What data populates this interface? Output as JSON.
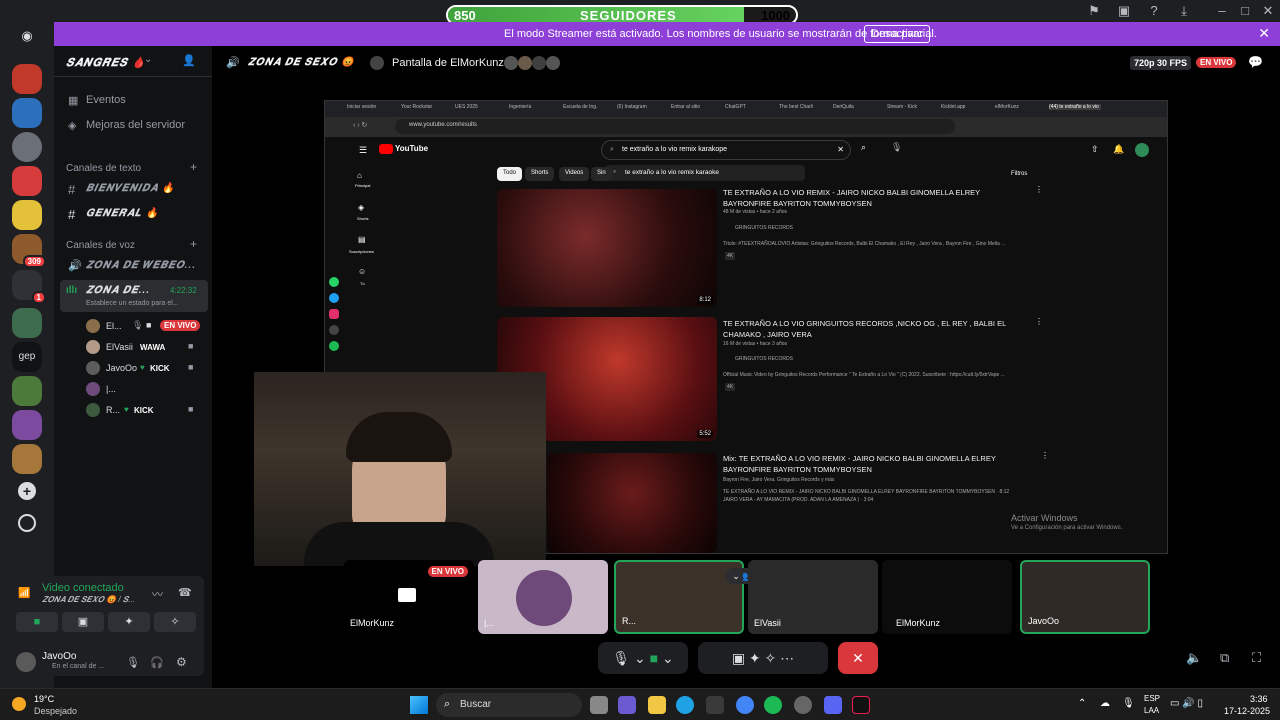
{
  "title_bar": {
    "subs_current": "850",
    "subs_label": "SEGUIDORES",
    "subs_goal": "1000",
    "subs_progress": 0.85
  },
  "banner": {
    "text": "El modo Streamer está activado. Los nombres de usuario se mostrarán de forma parcial.",
    "button": "Desactivar",
    "close": "✕"
  },
  "rail": {
    "badges": [
      "309",
      "1"
    ],
    "gep": "gep"
  },
  "sidebar": {
    "server_name": "𝑺𝑨𝑵𝑮𝑹𝑬𝑺 🩸",
    "events": "Eventos",
    "improvements": "Mejoras del servidor",
    "text_category": "Canales de texto",
    "text_channels": [
      "𝑩𝑰𝑬𝑵𝑽𝑬𝑵𝑰𝑫𝑨 🔥",
      "𝑮𝑬𝑵𝑬𝑹𝑨𝑳 🔥"
    ],
    "voice_category": "Canales de voz",
    "voice_channel_1": "𝒁𝑶𝑵𝑨 𝑫𝑬 𝑾𝑬𝑩𝑬𝑶...",
    "voice_channel_2": "𝒁𝑶𝑵𝑨 𝑫𝑬...",
    "voice_timer": "4:22:32",
    "status_hint": "Establece un estado para el...",
    "users": [
      {
        "name": "El...",
        "tag": "EN VIVO"
      },
      {
        "name": "ElVasii",
        "tag": "WAWA"
      },
      {
        "name": "JavoOo",
        "tag": "KICK"
      },
      {
        "name": "|...",
        "tag": ""
      },
      {
        "name": "R...",
        "tag": "KICK"
      }
    ]
  },
  "voice_panel": {
    "status": "Video conectado",
    "channel": "𝒁𝑶𝑵𝑨 𝑫𝑬 𝑺𝑬𝑿𝑶 😡 / 𝑺...",
    "user": "JavoOo",
    "user_status": "En el canal de ..."
  },
  "call_header": {
    "channel": "𝒁𝑶𝑵𝑨 𝑫𝑬 𝑺𝑬𝑿𝑶 😡",
    "screen_share": "Pantalla de ElMorKunz",
    "quality": "720p 30 FPS",
    "live": "EN VIVO"
  },
  "youtube": {
    "tabs": [
      "Iniciar sesión",
      "Your Rockstar",
      "UES 2025",
      "Ingeniería",
      "Escuela de Ing.",
      "(6) Instagram",
      "Entrar al sitio",
      "ChatGPT",
      "The best Charli",
      "DeriQuila",
      "Stream - Kick",
      "Kicklet.app",
      "elMorKunz",
      "(44) te extraño a lo vio"
    ],
    "url": "www.youtube.com/results",
    "logo": "YouTube",
    "search": "te extraño a lo vio remix karakope",
    "suggestion": "te extraño a lo vio remix karaoke",
    "filters": "Filtros",
    "chips": [
      "Todo",
      "Shorts",
      "Videos",
      "Sin"
    ],
    "nav": [
      "Principal",
      "Shorts",
      "Suscripciones",
      "Tú"
    ],
    "videos": [
      {
        "title": "TE EXTRAÑO A LO VIO REMIX - JAIRO NICKO BALBI GINOMELLA ELREY BAYRONFIRE BAYRITON TOMMYBOYSEN",
        "meta": "48 M de vistas • hace 2 años",
        "channel": "GRINGUITOS RECORDS",
        "desc": "Título: #TEEXTRAÑOALOVIO Artistas: Gringuitos Records, Balbi El Chamako , El Rey , Jairo Vera , Bayron Fire , Gino Mella ...",
        "badge": "4K",
        "duration": "8:12"
      },
      {
        "title": "TE EXTRAÑO A LO VIO GRINGUITOS RECORDS ,NICKO OG , EL REY , BALBI EL CHAMAKO , JAIRO VERA",
        "meta": "16 M de vistas • hace 3 años",
        "channel": "GRINGUITOS RECORDS",
        "desc": "Official Music Video by Gringuitos Records Performance \" Te Extraño a Lo Vio \" (C) 2022. Suscribete : https://cutt.ly/0xtrVape ...",
        "badge": "4K",
        "duration": "5:52"
      },
      {
        "title": "Mix: TE EXTRAÑO A LO VIO REMIX - JAIRO NICKO  BALBI GINOMELLA ELREY BAYRONFIRE BAYRITON TOMMYBOYSEN",
        "meta": "Bayron Fire, Jairo Vera, Gringuitos Records y más",
        "desc": "TE EXTRAÑO A LO VIO REMIX - JAIRO NICKO BALBI GINOMELLA ELREY BAYRONFIRE BAYRITON TOMMYBOYSEN · 8:12",
        "desc2": "JAIRO VERA - AY MAMACITA (PROD. ADAN LA AMENAZA ) · 3:04"
      }
    ],
    "watermark_1": "Activar Windows",
    "watermark_2": "Ve a Configuración para activar Windows."
  },
  "tiles": [
    {
      "name": "ElMorKunz",
      "live": "EN VIVO"
    },
    {
      "name": "|..."
    },
    {
      "name": "R..."
    },
    {
      "name": "ElVasii"
    },
    {
      "name": "ElMorKunz"
    },
    {
      "name": "JavoOo"
    }
  ],
  "taskbar": {
    "weather_temp": "19°C",
    "weather_desc": "Despejado",
    "search": "Buscar",
    "lang_1": "ESP",
    "lang_2": "LAA",
    "time": "3:36",
    "date": "17-12-2025"
  },
  "colors": {
    "banner": "#8d3fd8",
    "live": "#da373c",
    "green": "#23a55a",
    "kick": "#53fc18"
  }
}
